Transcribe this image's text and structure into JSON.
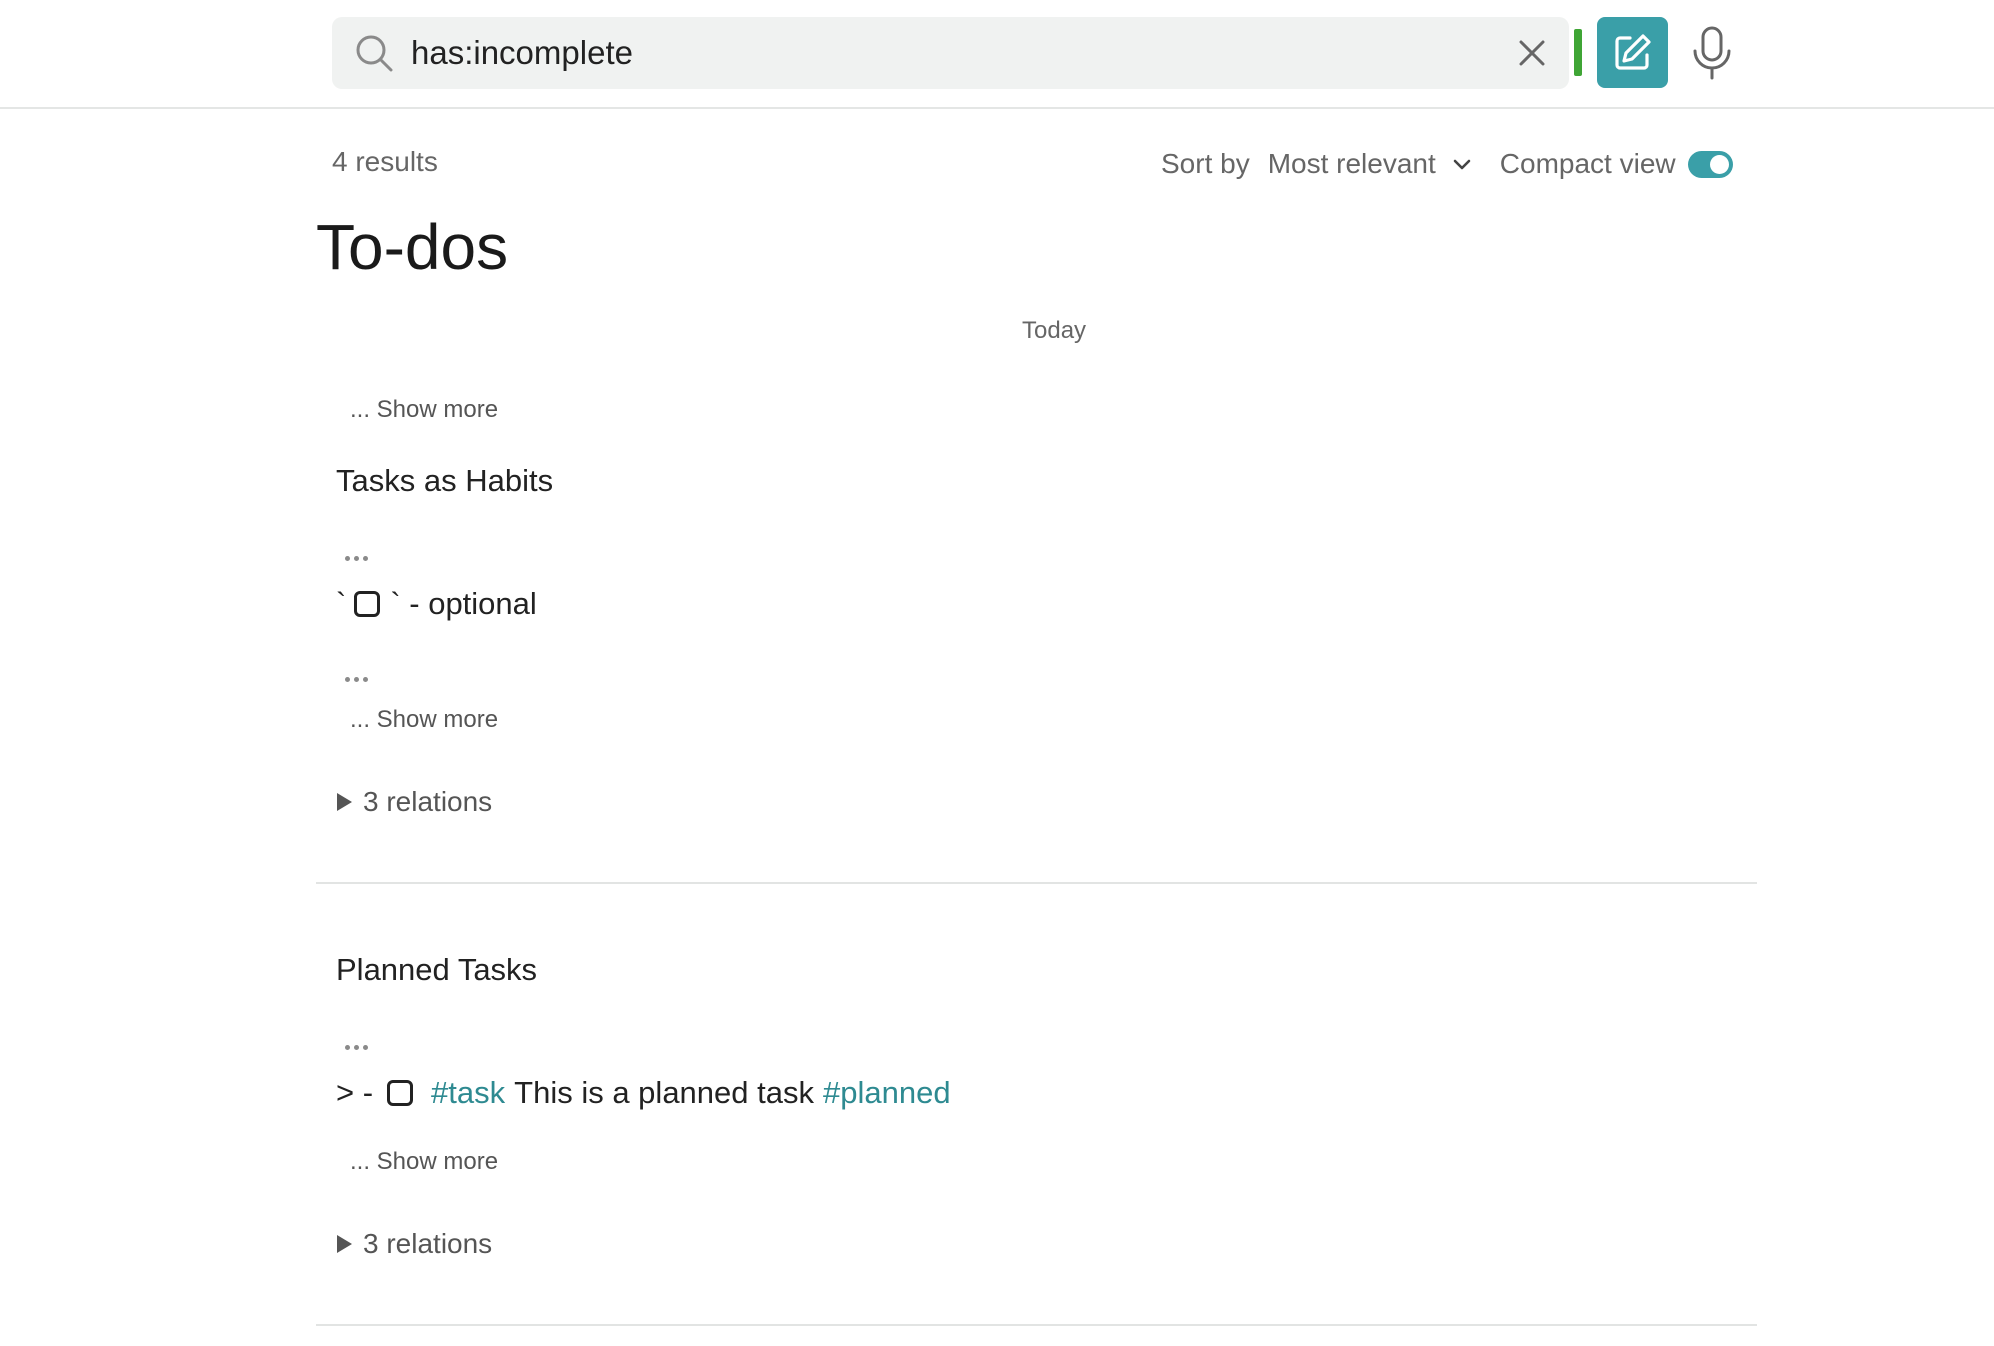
{
  "search": {
    "query": "has:incomplete",
    "placeholder": ""
  },
  "icons": {
    "search": "search-icon",
    "clear": "close-icon",
    "compose": "compose-icon",
    "mic": "microphone-icon",
    "sort_chevron": "chevron-down-icon",
    "relations": "triangle-right-icon"
  },
  "colors": {
    "accent": "#3a9fa8",
    "tag": "#2e8a91",
    "status_bar": "#3fa535"
  },
  "results": {
    "count_label": "4 results",
    "sort_label": "Sort by",
    "sort_value": "Most relevant",
    "compact_label": "Compact view",
    "compact_enabled": true
  },
  "page": {
    "title": "To-dos",
    "section_label": "Today"
  },
  "cards": [
    {
      "top_show_more": "... Show more",
      "title": "Tasks as Habits",
      "task": {
        "prefix": "`",
        "suffix": "` - optional"
      },
      "show_more": "... Show more",
      "relations": "3 relations"
    },
    {
      "title": "Planned Tasks",
      "task": {
        "prefix": "> -",
        "tag1": "#task",
        "text": "This is a planned task",
        "tag2": "#planned"
      },
      "show_more": "... Show more",
      "relations": "3 relations"
    }
  ]
}
